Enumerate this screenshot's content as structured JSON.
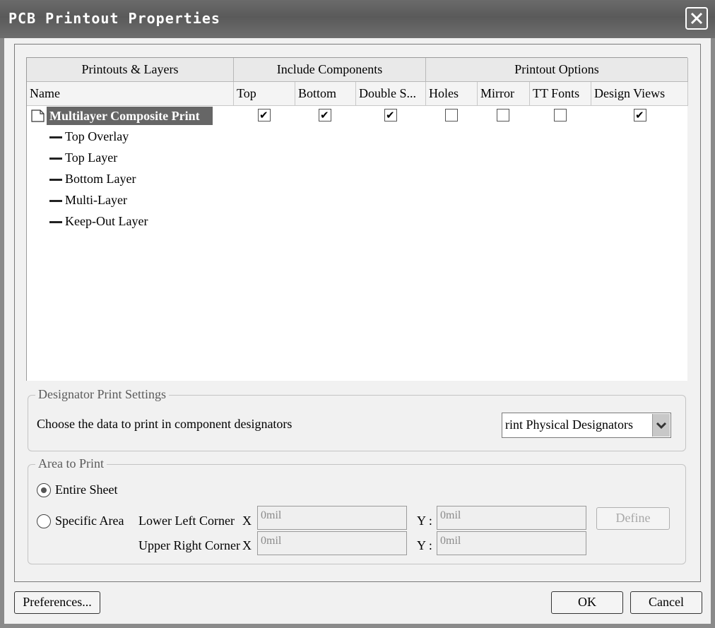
{
  "window": {
    "title": "PCB Printout Properties"
  },
  "grid": {
    "group_headers": [
      "Printouts & Layers",
      "Include Components",
      "Printout Options"
    ],
    "columns": [
      "Name",
      "Top",
      "Bottom",
      "Double S...",
      "Holes",
      "Mirror",
      "TT Fonts",
      "Design Views"
    ],
    "printout": {
      "name": "Multilayer Composite Print",
      "top": true,
      "bottom": true,
      "double_sided": true,
      "holes": false,
      "mirror": false,
      "tt_fonts": false,
      "design_views": true
    },
    "layers": [
      "Top Overlay",
      "Top Layer",
      "Bottom Layer",
      "Multi-Layer",
      "Keep-Out Layer"
    ]
  },
  "designator": {
    "group_title": "Designator Print Settings",
    "label": "Choose the data to print in component designators",
    "selected": "rint Physical Designators"
  },
  "area": {
    "group_title": "Area to Print",
    "entire_sheet": "Entire Sheet",
    "specific_area": "Specific Area",
    "entire_selected": true,
    "lower_left_label": "Lower Left Corner",
    "upper_right_label": "Upper Right Corner",
    "x_label": "X",
    "y_label": "Y :",
    "lower_left_x": "0mil",
    "lower_left_y": "0mil",
    "upper_right_x": "0mil",
    "upper_right_y": "0mil",
    "define_label": "Define"
  },
  "buttons": {
    "preferences": "Preferences...",
    "ok": "OK",
    "cancel": "Cancel"
  }
}
